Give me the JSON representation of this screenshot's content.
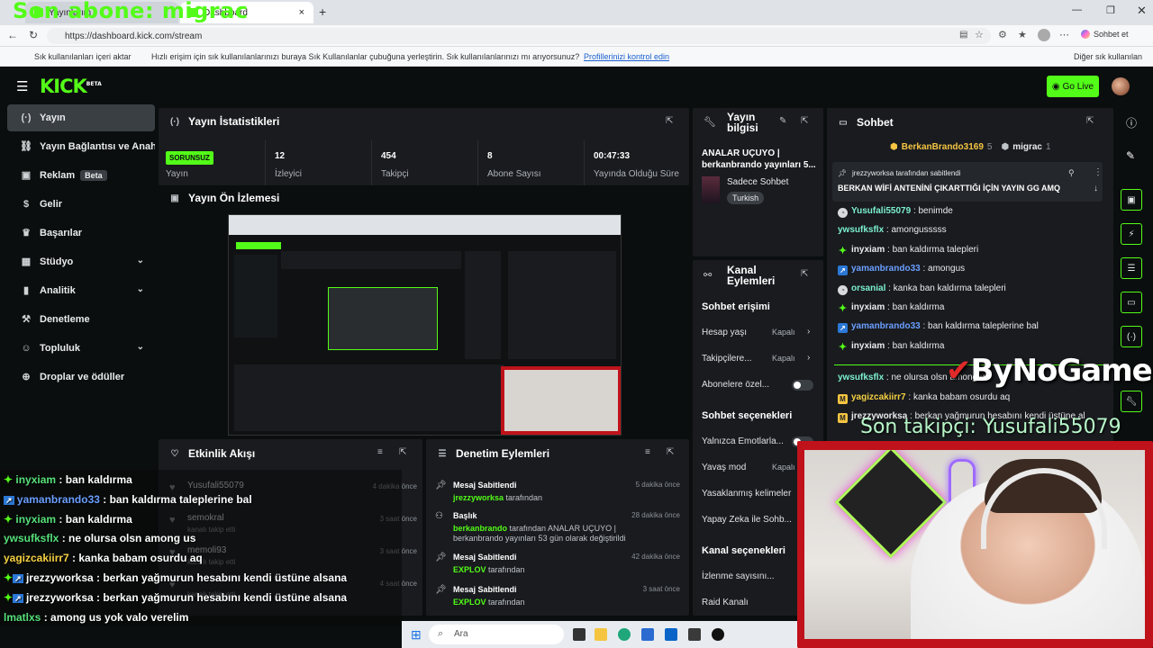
{
  "overlay": {
    "title": "Son abone: migrac",
    "last_follower": "Son takipçi: Yusufali55079",
    "brand": "ByNoGame",
    "chat": [
      {
        "user": "inyxiam",
        "text": " : ban kaldırma",
        "color": "#56e07a",
        "badge": "diamond"
      },
      {
        "user": "yamanbrando33",
        "text": " : ban kaldırma taleplerine bal",
        "color": "#6b9fff",
        "badge": "blue"
      },
      {
        "user": "inyxiam",
        "text": " : ban kaldırma",
        "color": "#56e07a",
        "badge": "diamond"
      },
      {
        "user": "ywsufksflx",
        "text": " : ne olursa olsn among us",
        "color": "#56e07a",
        "badge": "none"
      },
      {
        "user": "yagizcakiirr7",
        "text": " : kanka babam osurdu aq",
        "color": "#f5d142",
        "badge": "none"
      },
      {
        "user": "jrezzyworksa",
        "text": " : berkan yağmurun hesabını kendi üstüne alsana",
        "color": "#ffffff",
        "badge": "mod"
      },
      {
        "user": "jrezzyworksa",
        "text": " : berkan yağmurun hesabını kendi üstüne alsana",
        "color": "#ffffff",
        "badge": "mod"
      },
      {
        "user": "lmatlxs",
        "text": " : among us yok valo verelim",
        "color": "#56e07a",
        "badge": "none"
      }
    ]
  },
  "browser": {
    "tab1": "Yayınlarım",
    "tab2": "Dashboard",
    "url": "https://dashboard.kick.com/stream",
    "bookmarks_import": "Sık kullanılanları içeri aktar",
    "bookmarks_hint": "Hızlı erişim için sık kullanılanlarınızı buraya Sık Kullanılanlar çubuğuna yerleştirin. Sık kullanılanlarınızı mı arıyorsunuz?",
    "bookmarks_link": "Profillerinizi kontrol edin",
    "other_bookmarks": "Diğer sık kullanılan",
    "copilot": "Sohbet et"
  },
  "header": {
    "logo": "KICK",
    "beta": "BETA",
    "go_live": "Go Live"
  },
  "sidebar": [
    {
      "label": "Yayın",
      "icon": "broadcast-icon",
      "active": true
    },
    {
      "label": "Yayın Bağlantısı ve Anahtar",
      "icon": "link-icon"
    },
    {
      "label": "Reklam",
      "icon": "ad-icon",
      "badge": "Beta"
    },
    {
      "label": "Gelir",
      "icon": "money-icon"
    },
    {
      "label": "Başarılar",
      "icon": "trophy-icon"
    },
    {
      "label": "Stüdyo",
      "icon": "studio-icon",
      "chevron": true
    },
    {
      "label": "Analitik",
      "icon": "chart-icon",
      "chevron": true
    },
    {
      "label": "Denetleme",
      "icon": "gavel-icon"
    },
    {
      "label": "Topluluk",
      "icon": "community-icon",
      "chevron": true
    },
    {
      "label": "Droplar ve ödüller",
      "icon": "gift-icon"
    }
  ],
  "stats": {
    "title": "Yayın İstatistikleri",
    "status": "SORUNSUZ",
    "status_label": "Yayın",
    "items": [
      {
        "value": "12",
        "label": "İzleyici"
      },
      {
        "value": "454",
        "label": "Takipçi"
      },
      {
        "value": "8",
        "label": "Abone Sayısı"
      },
      {
        "value": "00:47:33",
        "label": "Yayında Olduğu Süre"
      }
    ]
  },
  "preview": {
    "title": "Yayın Ön İzlemesi"
  },
  "stream_info": {
    "title": "Yayın bilgisi",
    "stream_title": "ANALAR UÇUYO | berkanbrando yayınları 5...",
    "category": "Sadece Sohbet",
    "language": "Turkish"
  },
  "channel_actions": {
    "title": "Kanal Eylemleri",
    "chat_access": "Sohbet erişimi",
    "account_age": "Hesap yaşı",
    "followers": "Takipçilere...",
    "subs": "Abonelere özel...",
    "closed": "Kapalı",
    "chat_options": "Sohbet seçenekleri",
    "emote_only": "Yalnızca Emotlarla...",
    "slow_mode": "Yavaş mod",
    "banned_words": "Yasaklanmış kelimeler",
    "ai_chat": "Yapay Zeka ile Sohb...",
    "channel_options": "Kanal seçenekleri",
    "view_count": "İzlenme sayısını...",
    "raid": "Raid Kanalı"
  },
  "activity": {
    "title": "Etkinlik Akışı",
    "items": [
      {
        "name": "Yusufali55079",
        "sub": "",
        "time": "4 dakika önce"
      },
      {
        "name": "semokral",
        "sub": "kanalı takip etti",
        "time": "3 saat önce"
      },
      {
        "name": "memoli93",
        "sub": "kanalı takip etti",
        "time": "3 saat önce"
      },
      {
        "name": "",
        "sub": "kanalı takip etti",
        "time": "4 saat önce"
      }
    ]
  },
  "moderation": {
    "title": "Denetim Eylemleri",
    "items": [
      {
        "title": "Mesaj Sabitlendi",
        "user": "jrezzyworksa",
        "suffix": " tarafından",
        "time": "5 dakika önce",
        "icon": "pin-icon"
      },
      {
        "title": "Başlık",
        "user": "berkanbrando",
        "suffix": " tarafından ANALAR UÇUYO | berkanbrando yayınları 53 gün olarak değiştirildi",
        "time": "28 dakika önce",
        "icon": "people-icon"
      },
      {
        "title": "Mesaj Sabitlendi",
        "user": "EXPLOV",
        "suffix": " tarafından",
        "time": "42 dakika önce",
        "icon": "pin-icon"
      },
      {
        "title": "Mesaj Sabitlendi",
        "user": "EXPLOV",
        "suffix": " tarafından",
        "time": "3 saat önce",
        "icon": "pin-icon"
      }
    ]
  },
  "chat": {
    "title": "Sohbet",
    "top_gifters": [
      {
        "name": "BerkanBrando3169",
        "count": "5"
      },
      {
        "name": "migrac",
        "count": "1"
      }
    ],
    "pinned_by": "jrezzyworksa tarafından sabitlendi",
    "pinned_text": "BERKAN WİFİ ANTENİNİ ÇIKARTTIĞI İÇİN YAYIN GG AMQ",
    "messages": [
      {
        "user": "Yusufali55079",
        "text": ": benimde",
        "cls": "u5",
        "badge": "c"
      },
      {
        "user": "ywsufksflx",
        "text": ": amongusssss",
        "cls": "u5",
        "badge": ""
      },
      {
        "user": "inyxiam",
        "text": ": ban kaldırma talepleri",
        "cls": "u4",
        "badge": "g"
      },
      {
        "user": "yamanbrando33",
        "text": ": amongus",
        "cls": "u2",
        "badge": "b"
      },
      {
        "user": "orsanial",
        "text": ": kanka ban kaldırma talepleri",
        "cls": "u5",
        "badge": "c"
      },
      {
        "user": "inyxiam",
        "text": ": ban kaldırma",
        "cls": "u4",
        "badge": "g"
      },
      {
        "user": "yamanbrando33",
        "text": ": ban kaldırma taleplerine bal",
        "cls": "u2",
        "badge": "b"
      },
      {
        "user": "inyxiam",
        "text": ": ban kaldırma",
        "cls": "u4",
        "badge": "g"
      },
      {
        "user": "ywsufksflx",
        "text": ": ne olursa olsn among us",
        "cls": "u5",
        "badge": ""
      },
      {
        "user": "yagizcakiirr7",
        "text": ": kanka babam osurdu aq",
        "cls": "u3",
        "badge": "y"
      },
      {
        "user": "jrezzyworksa",
        "text": ": berkan yağmurun hesabını kendi üstüne al",
        "cls": "u4",
        "badge": "y"
      }
    ]
  },
  "taskbar": {
    "search": "Ara"
  }
}
